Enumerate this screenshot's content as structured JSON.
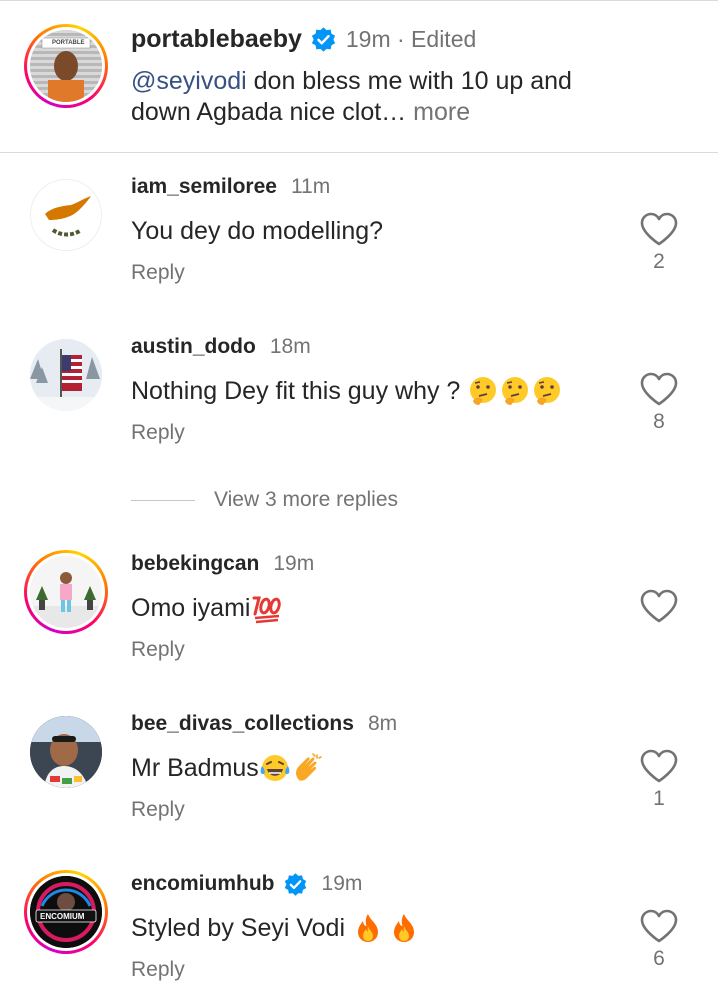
{
  "caption": {
    "username": "portablebaeby",
    "verified": true,
    "meta": "19m · Edited",
    "mention": "@seyivodi",
    "text": " don bless me with 10 up and down Agbada nice clot…",
    "more_label": " more",
    "avatar_sign_text": "PORTABLE"
  },
  "comments": [
    {
      "username": "iam_semiloree",
      "time": "11m",
      "message": "You dey do modelling?",
      "reply_label": "Reply",
      "likes": "2",
      "story_ring": false,
      "avatar": "cyprus-flag"
    },
    {
      "username": "austin_dodo",
      "time": "18m",
      "message": "Nothing Dey fit this guy why ? ",
      "emojis": [
        "thinking-face-emoji",
        "thinking-face-emoji",
        "thinking-face-emoji"
      ],
      "reply_label": "Reply",
      "likes": "8",
      "story_ring": false,
      "avatar": "us-flag-snow"
    },
    {
      "username": "bebekingcan",
      "time": "19m",
      "message": "Omo iyami",
      "emojis": [
        "hundred-points-emoji"
      ],
      "reply_label": "Reply",
      "likes": "",
      "story_ring": true,
      "avatar": "child-photo"
    },
    {
      "username": "bee_divas_collections",
      "time": "8m",
      "message": "Mr Badmus",
      "emojis": [
        "tears-of-joy-emoji",
        "clapping-hands-emoji"
      ],
      "reply_label": "Reply",
      "likes": "1",
      "story_ring": false,
      "avatar": "person-car"
    },
    {
      "username": "encomiumhub",
      "verified": true,
      "time": "19m",
      "message": "Styled by Seyi Vodi ",
      "emojis": [
        "fire-emoji",
        "fire-emoji"
      ],
      "reply_label": "Reply",
      "likes": "6",
      "story_ring": true,
      "avatar": "encomium-logo",
      "avatar_logo_text": "ENCOMIUM"
    }
  ],
  "view_more_replies": "View 3 more replies",
  "colors": {
    "text": "#262626",
    "secondary": "#737373",
    "mention": "#385185",
    "verified": "#0095f6",
    "divider": "#dbdbdb"
  }
}
